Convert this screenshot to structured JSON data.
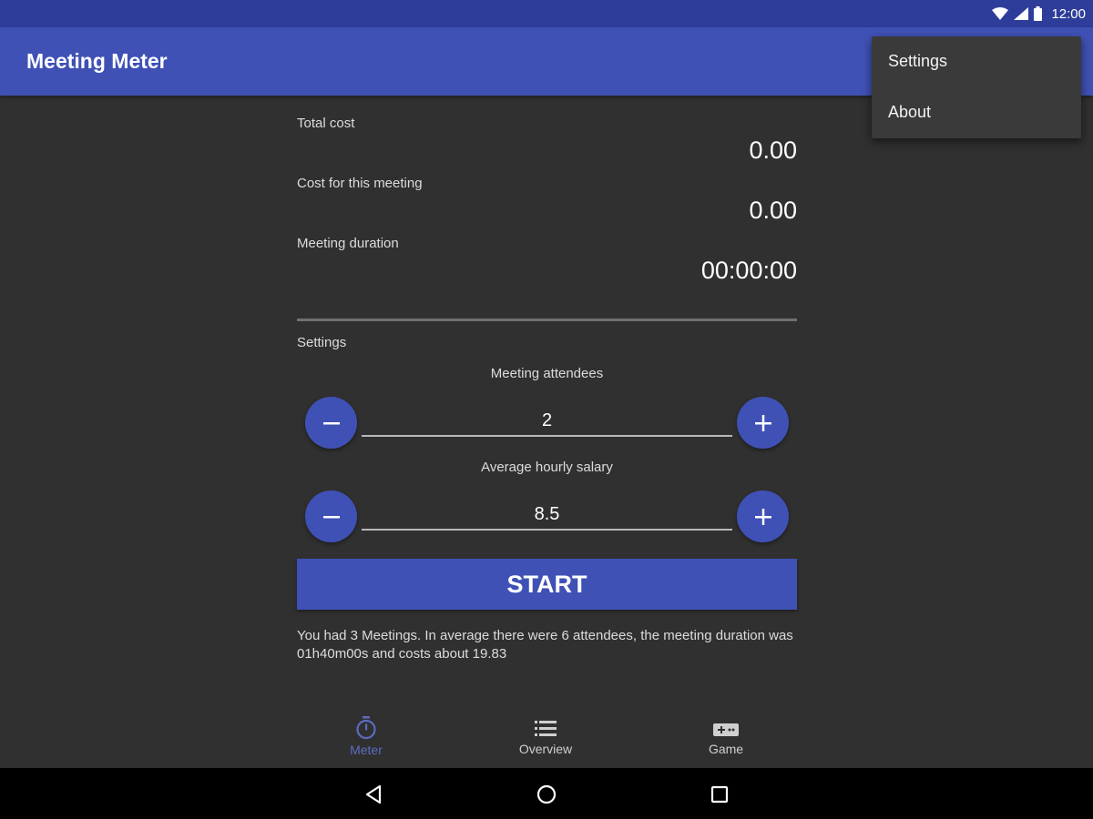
{
  "status_bar": {
    "time": "12:00"
  },
  "app_bar": {
    "title": "Meeting Meter"
  },
  "overflow_menu": {
    "items": [
      "Settings",
      "About"
    ]
  },
  "meter": {
    "total_cost_label": "Total cost",
    "total_cost_value": "0.00",
    "meeting_cost_label": "Cost for this meeting",
    "meeting_cost_value": "0.00",
    "duration_label": "Meeting duration",
    "duration_value": "00:00:00"
  },
  "settings": {
    "section_label": "Settings",
    "attendees_label": "Meeting attendees",
    "attendees_value": "2",
    "salary_label": "Average hourly salary",
    "salary_value": "8.5"
  },
  "start_button": {
    "label": "START"
  },
  "summary": {
    "text": "You had 3 Meetings. In average there were 6 attendees, the meeting duration was 01h40m00s and costs about 19.83"
  },
  "bottom_nav": {
    "items": [
      {
        "label": "Meter",
        "icon": "timer-icon",
        "active": true
      },
      {
        "label": "Overview",
        "icon": "list-icon",
        "active": false
      },
      {
        "label": "Game",
        "icon": "gamepad-icon",
        "active": false
      }
    ]
  },
  "colors": {
    "primary": "#3f51b5",
    "primary_dark": "#2f3d9a",
    "background": "#303030",
    "active_nav": "#5c6bc0",
    "inactive_nav": "#cfcfcf"
  }
}
